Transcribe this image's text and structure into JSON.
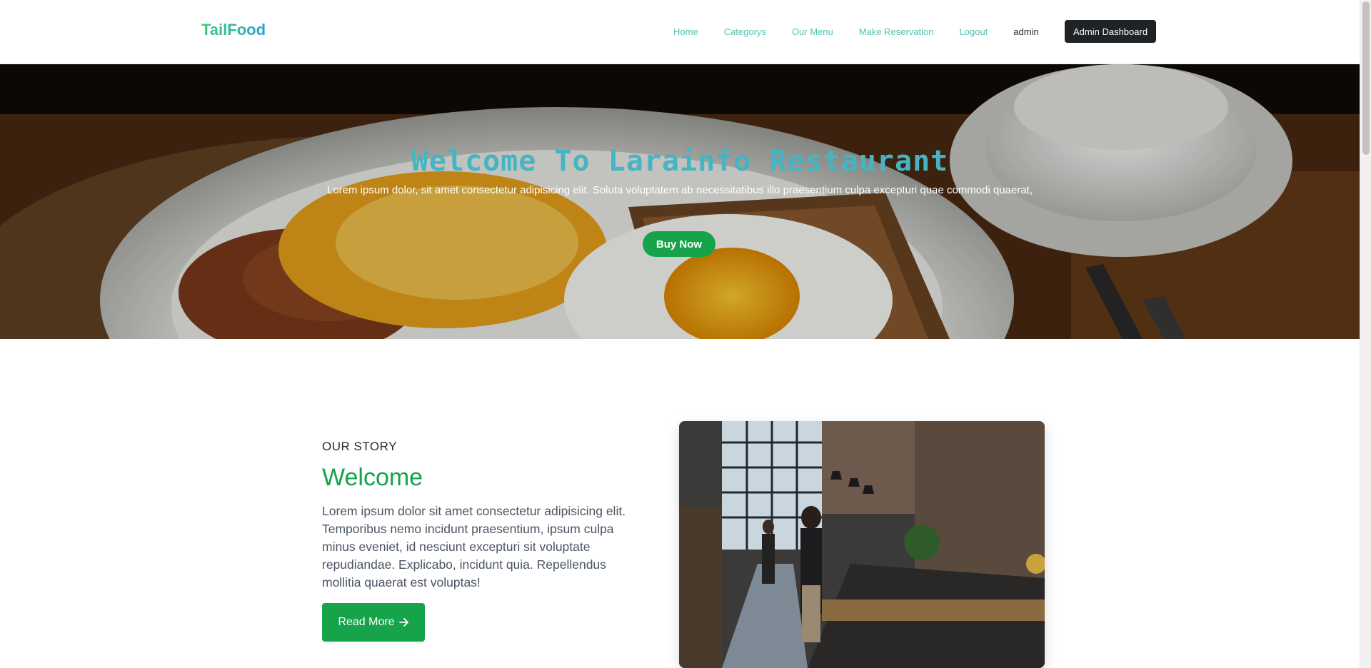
{
  "navbar": {
    "brand": "TailFood",
    "links": [
      {
        "label": "Home"
      },
      {
        "label": "Categorys"
      },
      {
        "label": "Our Menu"
      },
      {
        "label": "Make Reservation"
      },
      {
        "label": "Logout"
      }
    ],
    "user": "admin",
    "admin_button": "Admin Dashboard"
  },
  "hero": {
    "title": "Welcome To Larainfo Restaurant",
    "subtitle": "Lorem ipsum dolor, sit amet consectetur adipisicing elit. Soluta voluptatem ab necessitatibus illo praesentium culpa excepturi quae commodi quaerat,",
    "button": "Buy Now"
  },
  "story": {
    "kicker": "OUR STORY",
    "title": "Welcome",
    "body": "Lorem ipsum dolor sit amet consectetur adipisicing elit. Temporibus nemo incidunt praesentium, ipsum culpa minus eveniet, id nesciunt excepturi sit voluptate repudiandae. Explicabo, incidunt quia. Repellendus mollitia quaerat est voluptas!",
    "read_more": "Read More",
    "read_more_icon": "arrow-right-icon"
  },
  "colors": {
    "accent_green": "#16a34a",
    "nav_link": "#4fc3b0",
    "hero_title": "#45b5c4",
    "dark_button": "#1f2328"
  }
}
